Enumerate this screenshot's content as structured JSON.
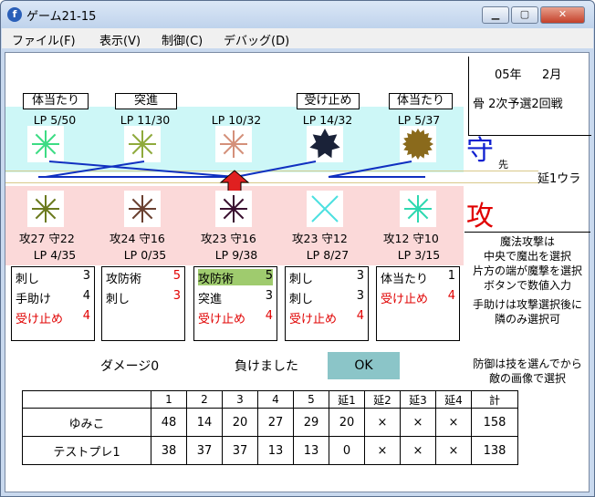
{
  "window": {
    "title": "ゲーム21-15"
  },
  "menu": [
    "ファイル(F)",
    "表示(V)",
    "制御(C)",
    "デバッグ(D)"
  ],
  "date": {
    "year_label": "05年",
    "month_label": "2月",
    "event": "骨 2次予選2回戦"
  },
  "defense": {
    "marker": "守",
    "order_label": "先",
    "extension_label": "延1ウラ",
    "slots": [
      {
        "skill": "体当たり",
        "lp": "LP 5/50",
        "color": "#3ddc84"
      },
      {
        "skill": "突進",
        "lp": "LP 11/30",
        "color": "#8faa3c"
      },
      {
        "skill": "",
        "lp": "LP 10/32",
        "color": "#d4907a"
      },
      {
        "skill": "受け止め",
        "lp": "LP 14/32",
        "color": "#1a2238"
      },
      {
        "skill": "体当たり",
        "lp": "LP 5/37",
        "color": "#8a6a1c"
      }
    ]
  },
  "attack": {
    "marker": "攻",
    "slots": [
      {
        "atk": "攻27",
        "def": "守22",
        "lp": "LP 4/35",
        "color": "#6b7a1e"
      },
      {
        "atk": "攻24",
        "def": "守16",
        "lp": "LP 0/35",
        "color": "#6a4030"
      },
      {
        "atk": "攻23",
        "def": "守16",
        "lp": "LP 9/38",
        "color": "#3a1030"
      },
      {
        "atk": "攻23",
        "def": "守12",
        "lp": "LP 8/27",
        "color": "#4de0e0"
      },
      {
        "atk": "攻12",
        "def": "守10",
        "lp": "LP 3/15",
        "color": "#2ed8b0"
      }
    ]
  },
  "cards": [
    [
      {
        "name": "刺し",
        "val": "3",
        "red": false
      },
      {
        "name": "手助け",
        "val": "4",
        "red": false
      },
      {
        "name": "受け止め",
        "val": "4",
        "red": true
      }
    ],
    [
      {
        "name": "攻防術",
        "val": "5",
        "red": false,
        "valred": true
      },
      {
        "name": "刺し",
        "val": "3",
        "red": false,
        "valred": true
      }
    ],
    [
      {
        "name": "攻防術",
        "val": "5",
        "red": false,
        "hl": true
      },
      {
        "name": "突進",
        "val": "3",
        "red": false
      },
      {
        "name": "受け止め",
        "val": "4",
        "red": true
      }
    ],
    [
      {
        "name": "刺し",
        "val": "3",
        "red": false
      },
      {
        "name": "刺し",
        "val": "3",
        "red": false
      },
      {
        "name": "受け止め",
        "val": "4",
        "red": true
      }
    ],
    [
      {
        "name": "体当たり",
        "val": "1",
        "red": false
      },
      {
        "name": "受け止め",
        "val": "4",
        "red": true
      }
    ]
  ],
  "help": {
    "magic": [
      "魔法攻撃は",
      "中央で魔出を選択",
      "片方の端が魔撃を選択",
      "ボタンで数値入力"
    ],
    "assist": [
      "手助けは攻撃選択後に",
      "隣のみ選択可"
    ],
    "defend": [
      "防御は技を選んでから",
      "敵の画像で選択"
    ]
  },
  "status": {
    "damage": "ダメージ0",
    "result": "負けました",
    "ok_label": "OK"
  },
  "score": {
    "headers": [
      "",
      "1",
      "2",
      "3",
      "4",
      "5",
      "延1",
      "延2",
      "延3",
      "延4",
      "計"
    ],
    "rows": [
      {
        "name": "ゆみこ",
        "cells": [
          "48",
          "14",
          "20",
          "27",
          "29",
          "20",
          "×",
          "×",
          "×",
          "158"
        ]
      },
      {
        "name": "テストプレ1",
        "cells": [
          "38",
          "37",
          "37",
          "13",
          "13",
          "0",
          "×",
          "×",
          "×",
          "138"
        ]
      }
    ]
  }
}
